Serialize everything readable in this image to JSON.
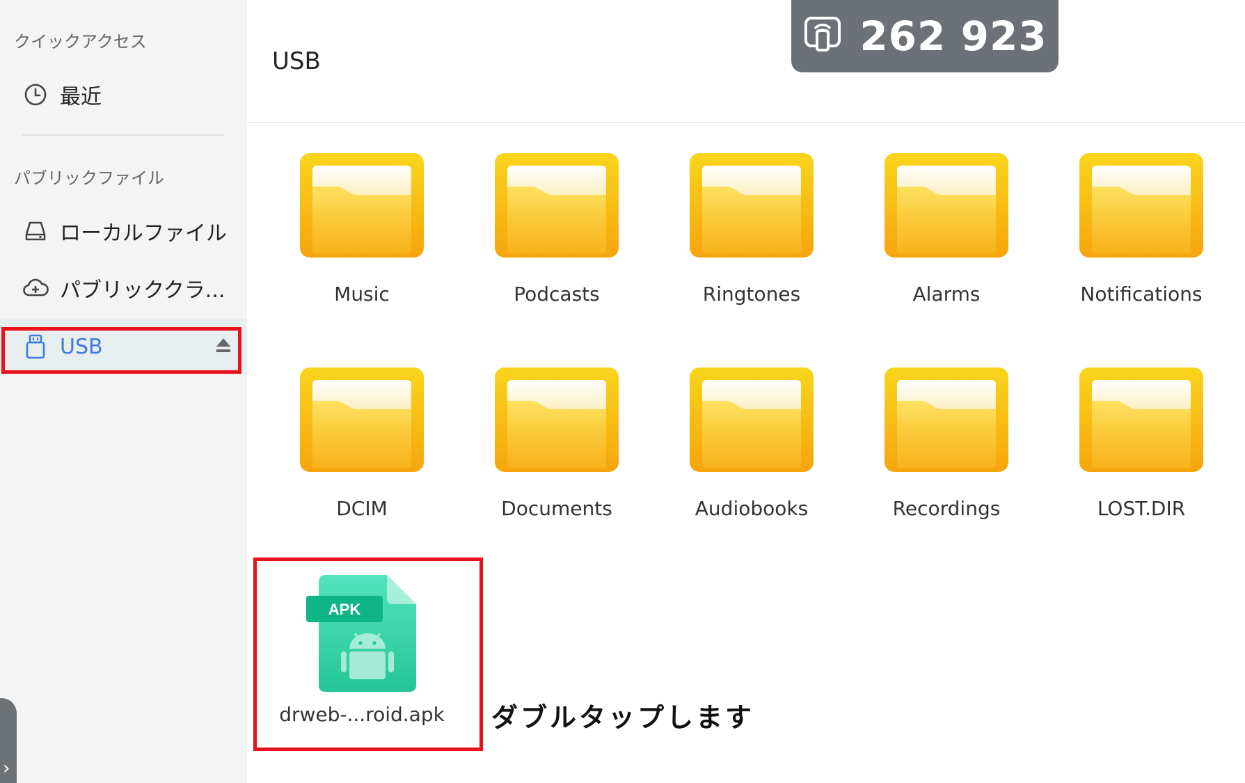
{
  "sidebar": {
    "quick_access_title": "クイックアクセス",
    "recent_label": "最近",
    "public_files_title": "パブリックファイル",
    "local_files_label": "ローカルファイル",
    "public_cloud_label": "パブリッククラ...",
    "usb_label": "USB",
    "collapse_glyph": "›"
  },
  "header": {
    "title": "USB"
  },
  "badge": {
    "code": "262 923"
  },
  "folders": [
    {
      "name": "Music"
    },
    {
      "name": "Podcasts"
    },
    {
      "name": "Ringtones"
    },
    {
      "name": "Alarms"
    },
    {
      "name": "Notifications"
    },
    {
      "name": "DCIM"
    },
    {
      "name": "Documents"
    },
    {
      "name": "Audiobooks"
    },
    {
      "name": "Recordings"
    },
    {
      "name": "LOST.DIR"
    }
  ],
  "apk_file": {
    "badge": "APK",
    "name": "drweb-...roid.apk"
  },
  "annotation": {
    "hint": "ダブルタップします"
  },
  "colors": {
    "accent": "#3d7bdc",
    "highlight_box": "#e8121c",
    "folder_yellow": "#f8c81a",
    "apk_green": "#2fd0a3"
  }
}
